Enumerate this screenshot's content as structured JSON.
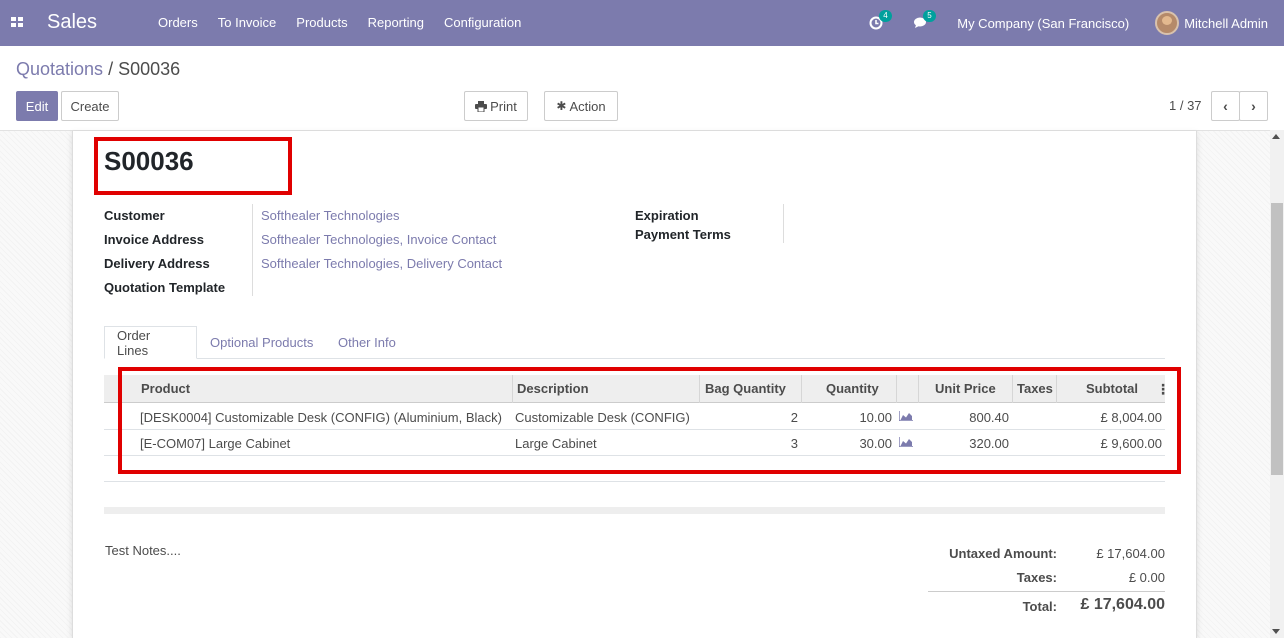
{
  "navbar": {
    "app_title": "Sales",
    "menu": [
      "Orders",
      "To Invoice",
      "Products",
      "Reporting",
      "Configuration"
    ],
    "activity_count": "4",
    "messages_count": "5",
    "company": "My Company (San Francisco)",
    "user": "Mitchell Admin"
  },
  "breadcrumb": {
    "parent": "Quotations",
    "separator": "/",
    "current": "S00036"
  },
  "toolbar": {
    "edit": "Edit",
    "create": "Create",
    "print": "Print",
    "action": "Action"
  },
  "pager": {
    "value": "1 / 37"
  },
  "form": {
    "name": "S00036",
    "left_fields": [
      {
        "label": "Customer",
        "value": "Softhealer Technologies"
      },
      {
        "label": "Invoice Address",
        "value": "Softhealer Technologies, Invoice Contact"
      },
      {
        "label": "Delivery Address",
        "value": "Softhealer Technologies, Delivery Contact"
      },
      {
        "label": "Quotation Template",
        "value": ""
      }
    ],
    "right_fields": [
      {
        "label": "Expiration",
        "value": ""
      },
      {
        "label": "Payment Terms",
        "value": ""
      }
    ]
  },
  "tabs": [
    "Order Lines",
    "Optional Products",
    "Other Info"
  ],
  "order_lines": {
    "columns": [
      "Product",
      "Description",
      "Bag Quantity",
      "Quantity",
      "Unit Price",
      "Taxes",
      "Subtotal"
    ],
    "rows": [
      {
        "product": "[DESK0004] Customizable Desk (CONFIG) (Aluminium, Black)",
        "description": "Customizable Desk (CONFIG)",
        "bag_qty": "2",
        "qty": "10.00",
        "unit_price": "800.40",
        "taxes": "",
        "subtotal": "£ 8,004.00"
      },
      {
        "product": "[E-COM07] Large Cabinet",
        "description": "Large Cabinet",
        "bag_qty": "3",
        "qty": "30.00",
        "unit_price": "320.00",
        "taxes": "",
        "subtotal": "£ 9,600.00"
      }
    ]
  },
  "notes": "Test Notes....",
  "totals": {
    "untaxed_label": "Untaxed Amount:",
    "untaxed_value": "£ 17,604.00",
    "taxes_label": "Taxes:",
    "taxes_value": "£ 0.00",
    "total_label": "Total:",
    "total_value": "£ 17,604.00"
  },
  "colors": {
    "brand": "#7c7bad",
    "highlight": "#e00000",
    "badge": "#00a09d"
  }
}
